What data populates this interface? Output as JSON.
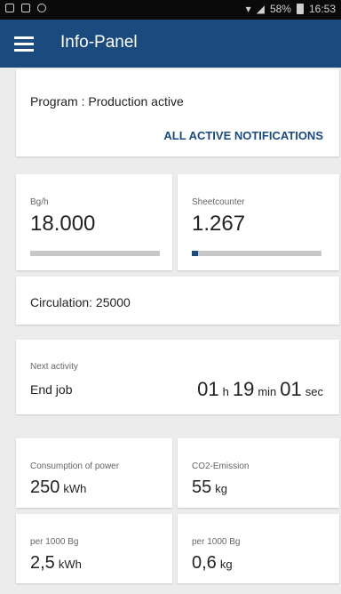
{
  "status_bar": {
    "battery": "58%",
    "time": "16:53"
  },
  "app_bar": {
    "title": "Info-Panel",
    "menu_icon": "hamburger-menu-icon"
  },
  "program": {
    "status_text": "Program : Production active",
    "notifications_link": "ALL ACTIVE NOTIFICATIONS"
  },
  "metrics": [
    {
      "label": "Bg/h",
      "value": "18.000",
      "progress": 0.0
    },
    {
      "label": "Sheetcounter",
      "value": "1.267",
      "progress": 0.05
    }
  ],
  "circulation": {
    "text": "Circulation: 25000"
  },
  "next_activity": {
    "label": "Next activity",
    "value": "End job",
    "hours": "01",
    "hours_unit": "h",
    "minutes": "19",
    "minutes_unit": "min",
    "seconds": "01",
    "seconds_unit": "sec"
  },
  "energy": [
    {
      "label": "Consumption of power",
      "value": "250",
      "unit": "kWh"
    },
    {
      "label": "CO2-Emission",
      "value": "55",
      "unit": "kg"
    },
    {
      "label": "per 1000 Bg",
      "value": "2,5",
      "unit": "kWh"
    },
    {
      "label": "per 1000 Bg",
      "value": "0,6",
      "unit": "kg"
    }
  ],
  "colors": {
    "accent": "#1b4a7f",
    "progress_track": "#c8c8c8"
  }
}
